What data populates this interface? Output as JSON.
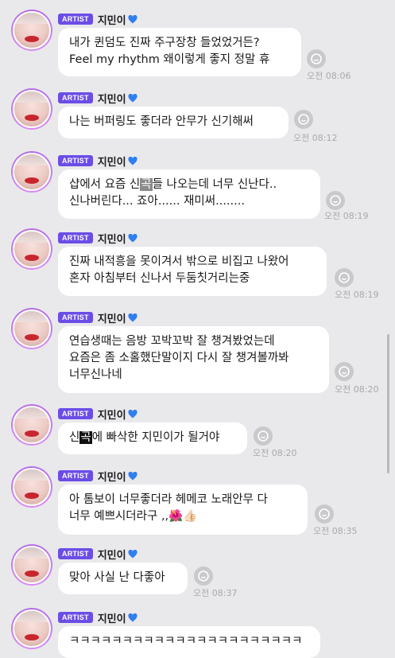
{
  "badge_label": "ARTIST",
  "author_name": "지민이",
  "messages": [
    {
      "lines": [
        "내가 퀸덤도 진짜 주구장창 들었었거든?",
        "Feel my rhythm 왜이렇게 좋지 정말 휴"
      ],
      "time": "오전 08:06"
    },
    {
      "lines": [
        "나는 버퍼링도 좋더라 안무가 신기해써"
      ],
      "time": "오전 08:12"
    },
    {
      "lines": [
        "샵에서 요즘 신곡들 나오는데 너무 신난다..",
        "신나버린다... 죠아...... 재미써........"
      ],
      "time": "오전 08:19"
    },
    {
      "lines": [
        "진짜 내적흥을 못이겨서 밖으로 비집고 나왔어",
        "혼자 아침부터 신나서 두둠칫거리는중"
      ],
      "time": "오전 08:19"
    },
    {
      "lines": [
        "연습생때는 음방 꼬박꼬박 잘 챙겨봤었는데",
        "요즘은 좀 소홀했단말이지 다시 잘 챙겨볼까봐",
        "너무신나네"
      ],
      "time": "오전 08:20"
    },
    {
      "lines": [
        "신곡에 빠삭한 지민이가 될거야"
      ],
      "time": "오전 08:20"
    },
    {
      "lines": [
        "아 톰보이 너무좋더라 헤메코 노래안무 다",
        "너무 예쁘시더라구 ,,🌺👍🏻"
      ],
      "time": "오전 08:35"
    },
    {
      "lines": [
        "맞아 사실 난 다좋아"
      ],
      "time": "오전 08:37"
    },
    {
      "lines": [
        "ㅋㅋㅋㅋㅋㅋㅋㅋㅋㅋㅋㅋㅋㅋㅋㅋㅋㅋㅋㅋㅋㅋ"
      ],
      "time": ""
    }
  ],
  "colors": {
    "badge": "#6b4de6",
    "background": "#e9e9ec",
    "bubble": "#ffffff",
    "heart": "#2f7ff0"
  },
  "icons": {
    "reaction": "reaction-add-icon",
    "heart": "blue-heart-icon"
  }
}
